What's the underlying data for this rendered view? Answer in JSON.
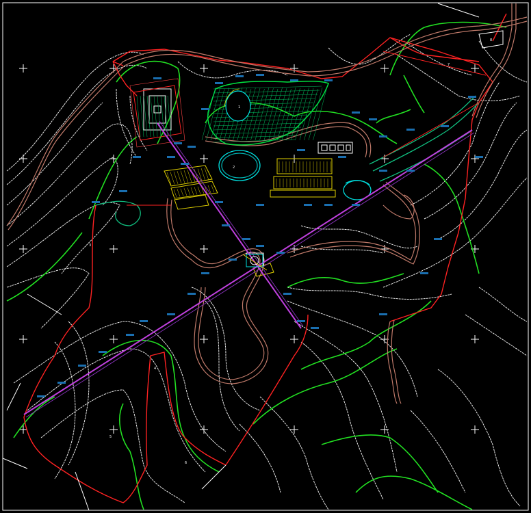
{
  "drawing": {
    "background": "#000000",
    "frame_color": "#ffffff",
    "colors": {
      "contour_minor": "#e8e8e8",
      "contour_major": "#22e022",
      "boundary": "#ff2222",
      "road": "#c07a6a",
      "axis": "#c040e0",
      "building_cyan": "#00e0e0",
      "building_yellow": "#e0d000",
      "text_blue": "#5ad0ff"
    },
    "crosshair_icon": "plus-crosshair",
    "zones": [
      {
        "id": "z1",
        "text": "1"
      },
      {
        "id": "z2",
        "text": "2"
      },
      {
        "id": "z3",
        "text": "3"
      },
      {
        "id": "z4",
        "text": "4"
      },
      {
        "id": "z5",
        "text": "5"
      },
      {
        "id": "z6",
        "text": "6"
      },
      {
        "id": "z7",
        "text": "7"
      },
      {
        "id": "z8",
        "text": "8"
      }
    ]
  }
}
